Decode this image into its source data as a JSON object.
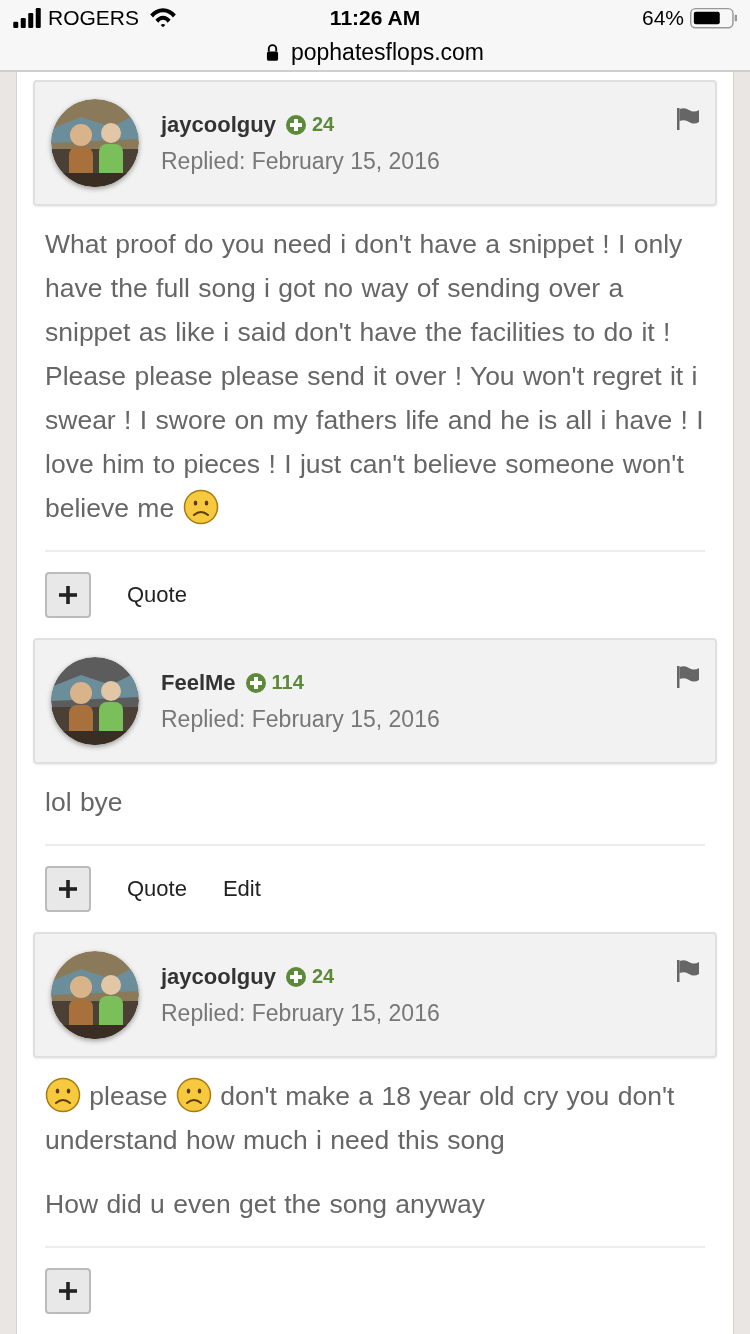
{
  "status_bar": {
    "carrier": "ROGERS",
    "time": "11:26 AM",
    "battery": "64%"
  },
  "address_bar": {
    "url": "pophatesflops.com"
  },
  "posts": [
    {
      "author": "jaycoolguy",
      "reputation": "24",
      "date": "Replied: February 15, 2016",
      "avatar": {
        "kind": "picture"
      },
      "paragraphs": [
        [
          {
            "kind": "text",
            "text": "What proof do you need i don't have a snippet ! I only have the full song i got no way of sending over a snippet as like i said don't have the facilities to do it ! Please please please send it over ! You won't regret it i swear ! I swore on my fathers life and he is all i have ! I love him to pieces ! I just can't believe someone won't believe me "
          },
          {
            "kind": "sad"
          }
        ]
      ],
      "actions": [
        "Quote"
      ]
    },
    {
      "author": "FeelMe",
      "reputation": "114",
      "date": "Replied: February 15, 2016",
      "avatar": {
        "kind": "picture"
      },
      "paragraphs": [
        [
          {
            "kind": "text",
            "text": "lol bye"
          }
        ]
      ],
      "actions": [
        "Quote",
        "Edit"
      ]
    },
    {
      "author": "jaycoolguy",
      "reputation": "24",
      "date": "Replied: February 15, 2016",
      "avatar": {
        "kind": "picture"
      },
      "paragraphs": [
        [
          {
            "kind": "sad"
          },
          {
            "kind": "text",
            "text": " please "
          },
          {
            "kind": "sad"
          },
          {
            "kind": "text",
            "text": " don't make a 18 year old cry you don't understand how much i need this song"
          }
        ],
        [
          {
            "kind": "text",
            "text": "How did u even get the song anyway"
          }
        ]
      ]
    }
  ]
}
